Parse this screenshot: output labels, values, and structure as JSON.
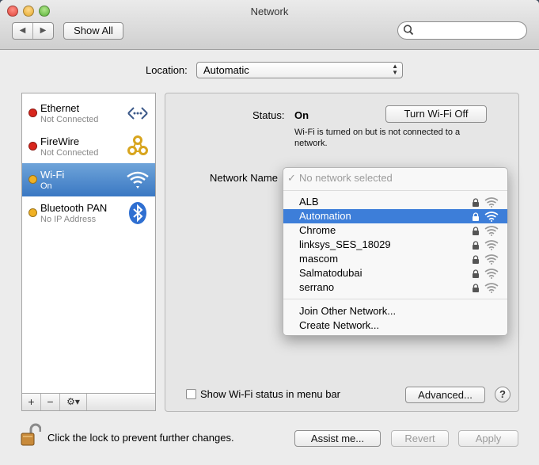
{
  "window": {
    "title": "Network"
  },
  "toolbar": {
    "back": "◀",
    "forward": "▶",
    "show_all": "Show All"
  },
  "location": {
    "label": "Location:",
    "value": "Automatic"
  },
  "sidebar": {
    "items": [
      {
        "name": "Ethernet",
        "status": "Not Connected",
        "dot_color": "#d8261d",
        "icon": "ethernet-icon"
      },
      {
        "name": "FireWire",
        "status": "Not Connected",
        "dot_color": "#d8261d",
        "icon": "firewire-icon"
      },
      {
        "name": "Wi-Fi",
        "status": "On",
        "dot_color": "#f0b124",
        "icon": "wifi-icon",
        "selected": true
      },
      {
        "name": "Bluetooth PAN",
        "status": "No IP Address",
        "dot_color": "#f0b124",
        "icon": "bluetooth-icon"
      }
    ],
    "tools": {
      "add": "+",
      "remove": "−",
      "gear": "⚙▾"
    }
  },
  "panel": {
    "status_label": "Status:",
    "status_value": "On",
    "turn_off_button": "Turn Wi-Fi Off",
    "status_desc_line1": "Wi-Fi is turned on but is not connected to a",
    "status_desc_line2": "network.",
    "network_name_label": "Network Name",
    "show_status_label": "Show Wi-Fi status in menu bar",
    "advanced_button": "Advanced...",
    "help_button": "?"
  },
  "network_menu": {
    "header": "No network selected",
    "checkmark": "✓",
    "networks": [
      {
        "name": "ALB",
        "selected": false
      },
      {
        "name": "Automation",
        "selected": true
      },
      {
        "name": "Chrome",
        "selected": false
      },
      {
        "name": "linksys_SES_18029",
        "selected": false
      },
      {
        "name": "mascom",
        "selected": false
      },
      {
        "name": "Salmatodubai",
        "selected": false
      },
      {
        "name": "serrano",
        "selected": false
      }
    ],
    "join_other": "Join Other Network...",
    "create": "Create Network..."
  },
  "footer": {
    "lock_text": "Click the lock to prevent further changes.",
    "assist_button": "Assist me...",
    "revert_button": "Revert",
    "apply_button": "Apply"
  },
  "colors": {
    "selection": "#3d7ed9",
    "red_dot": "#d8261d",
    "yellow_dot": "#f0b124"
  }
}
